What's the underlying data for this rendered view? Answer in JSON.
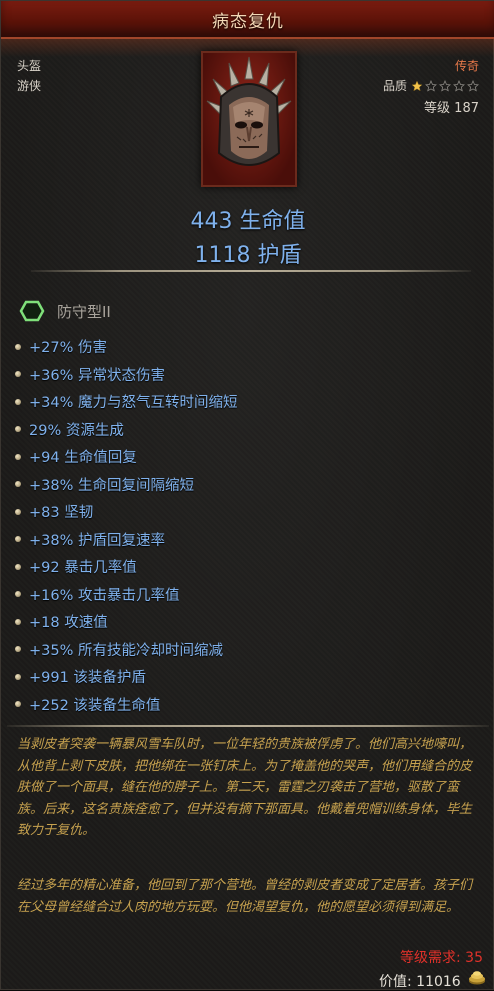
{
  "item": {
    "name": "病态复仇",
    "type": "头盔",
    "class": "游侠",
    "rarity": "传奇",
    "quality_label": "品质",
    "quality_stars": 1,
    "quality_max": 5,
    "level_label": "等级 187",
    "icon": "spiked-mask-helmet-icon",
    "main_stats": [
      "443 生命值",
      "1118 护盾"
    ]
  },
  "socket": {
    "icon": "hexagon-socket-icon",
    "label": "防守型II"
  },
  "affixes": [
    "+27% 伤害",
    "+36% 异常状态伤害",
    "+34% 魔力与怒气互转时间缩短",
    "29% 资源生成",
    "+94 生命值回复",
    "+38% 生命回复间隔缩短",
    "+83 坚韧",
    "+38% 护盾回复速率",
    "+92 暴击几率值",
    "+16% 攻击暴击几率值",
    "+18 攻速值",
    "+35% 所有技能冷却时间缩减",
    "+991 该装备护盾",
    "+252 该装备生命值"
  ],
  "lore": [
    "当剥皮者突袭一辆暴风雪车队时，一位年轻的贵族被俘虏了。他们高兴地嚎叫，从他背上剥下皮肤，把他绑在一张钉床上。为了掩盖他的哭声，他们用缝合的皮肤做了一个面具，缝在他的脖子上。第二天，雷霆之刃袭击了营地，驱散了蛮族。后来，这名贵族痊愈了，但并没有摘下那面具。他戴着兜帽训练身体，毕生致力于复仇。",
    "经过多年的精心准备，他回到了那个营地。曾经的剥皮者变成了定居者。孩子们在父母曾经缝合过人肉的地方玩耍。但他渴望复仇，他的愿望必须得到满足。"
  ],
  "footer": {
    "requirement": "等级需求: 35",
    "value": "价值: 11016",
    "currency_icon": "gold-coin-icon"
  },
  "colors": {
    "title_bar": "#5a1208",
    "rarity": "#e8794a",
    "stat_blue": "#7fb1ec",
    "lore_gold": "#c7a24f",
    "requirement_red": "#e0312a",
    "socket_green": "#7fe07a"
  }
}
